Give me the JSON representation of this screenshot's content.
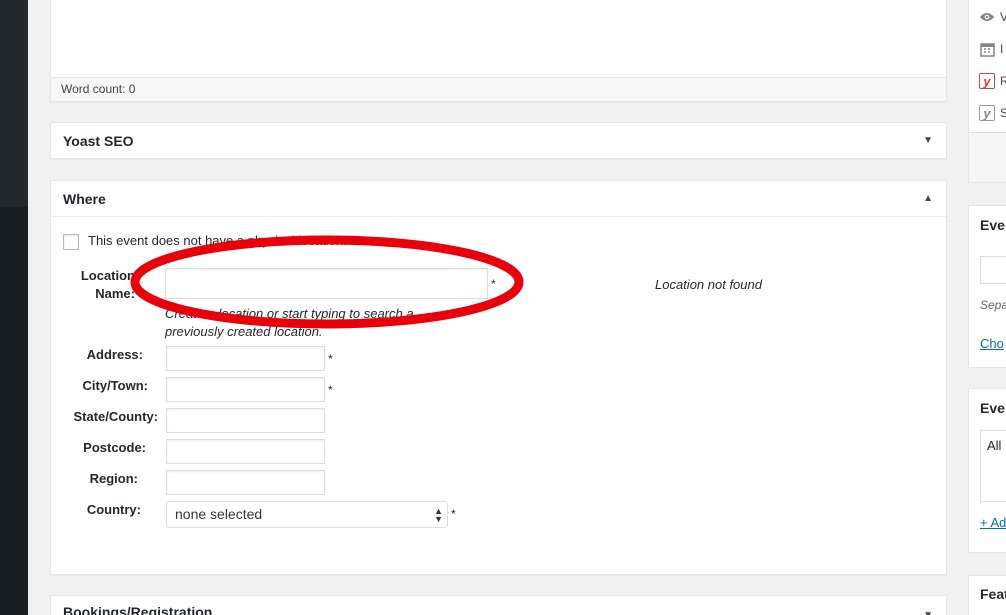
{
  "editor": {
    "word_count_label": "Word count: 0"
  },
  "yoast": {
    "title": "Yoast SEO",
    "toggle": "▼"
  },
  "where": {
    "title": "Where",
    "toggle": "▲",
    "no_physical_location_label": "This event does not have a physical location.",
    "location_name_label_1": "Location",
    "location_name_label_2": "Name:",
    "location_name_value": "",
    "location_name_help_1": "Create a location or start typing to search a",
    "location_name_help_2": "previously created location.",
    "location_not_found": "Location not found",
    "required_mark": "*",
    "fields": {
      "address": {
        "label": "Address:",
        "value": ""
      },
      "city": {
        "label": "City/Town:",
        "value": ""
      },
      "state": {
        "label": "State/County:",
        "value": ""
      },
      "postcode": {
        "label": "Postcode:",
        "value": ""
      },
      "region": {
        "label": "Region:",
        "value": ""
      },
      "country": {
        "label": "Country:",
        "selected": "none selected"
      }
    }
  },
  "bookings": {
    "title": "Bookings/Registration"
  },
  "sidebar": {
    "publish_rows": [
      {
        "icon": "eye-icon",
        "text": "V"
      },
      {
        "icon": "calendar-icon",
        "text": "I"
      },
      {
        "icon": "yoast-readability-icon",
        "text": "R"
      },
      {
        "icon": "yoast-seo-icon",
        "text": "S"
      }
    ],
    "event_box_1": {
      "title": "Eve",
      "hint": "Sepa",
      "link": "Cho"
    },
    "event_box_2": {
      "title": "Eve",
      "option": "All",
      "link": "+ Ad"
    },
    "featured": {
      "title": "Feat"
    }
  },
  "colors": {
    "highlight_ellipse": "#e8000b",
    "link": "#0073aa",
    "yoast_red": "#d93f3f"
  }
}
